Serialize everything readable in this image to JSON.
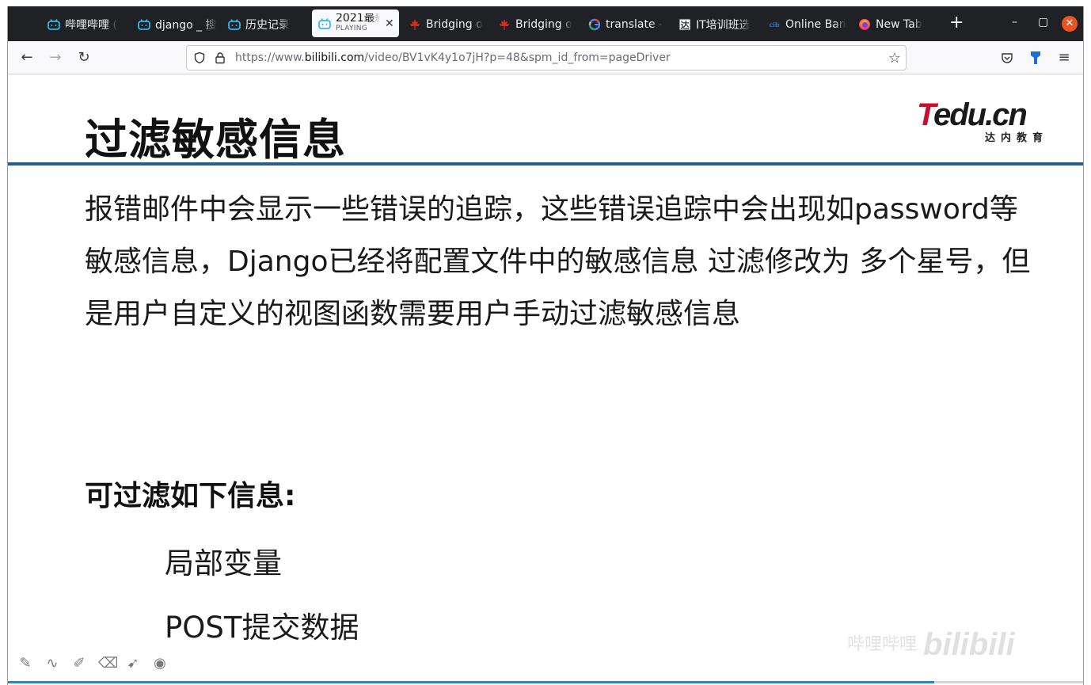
{
  "tabs": [
    {
      "label": "哔哩哔哩 (",
      "icon": "bilibili-icon"
    },
    {
      "label": "django _ 搜",
      "icon": "bilibili-icon"
    },
    {
      "label": "历史记录",
      "icon": "bilibili-icon"
    },
    {
      "label": "2021最新",
      "sub": "PLAYING",
      "icon": "bilibili-icon",
      "active": true
    },
    {
      "label": "Bridging o",
      "icon": "maple-leaf-icon"
    },
    {
      "label": "Bridging o",
      "icon": "maple-leaf-icon"
    },
    {
      "label": "translate -",
      "icon": "google-icon"
    },
    {
      "label": "IT培训班选",
      "icon": "tarena-icon"
    },
    {
      "label": "Online Ban",
      "icon": "bank-icon"
    },
    {
      "label": "New Tab",
      "icon": "firefox-icon"
    }
  ],
  "url": {
    "prefix": "https://www.",
    "domain": "bilibili.com",
    "path": "/video/BV1vK4y1o7jH?p=48&spm_id_from=pageDriver"
  },
  "slide": {
    "title": "过滤敏感信息",
    "logo_t": "T",
    "logo_rest": "edu.cn",
    "logo_sub": "达内教育",
    "paragraph": "报错邮件中会显示一些错误的追踪，这些错误追踪中会出现如password等敏感信息，Django已经将配置文件中的敏感信息 过滤修改为   多个星号，但是用户自定义的视图函数需要用户手动过滤敏感信息",
    "subheading": "可过滤如下信息:",
    "items": [
      "局部变量",
      "POST提交数据"
    ]
  },
  "watermark": {
    "text": "哔哩哔哩",
    "brand": "bilibili"
  },
  "progress_fraction": 0.86,
  "colors": {
    "accent_blue": "#1f5fa0",
    "logo_red": "#c8102e",
    "close_orange": "#e95420"
  }
}
